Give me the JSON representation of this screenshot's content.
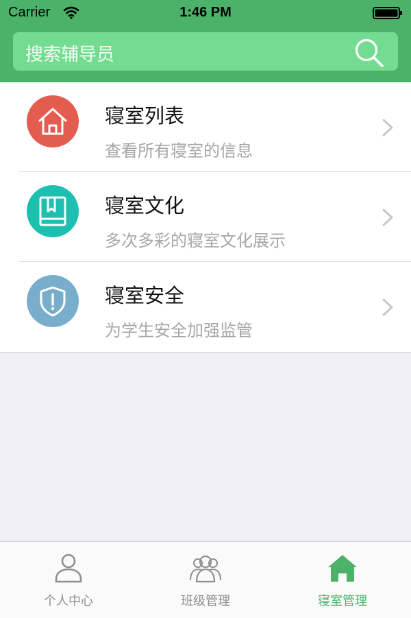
{
  "status_bar": {
    "carrier": "Carrier",
    "time": "1:46 PM"
  },
  "search": {
    "placeholder": "搜索辅导员"
  },
  "menu": [
    {
      "title": "寝室列表",
      "subtitle": "查看所有寝室的信息",
      "icon": "house-icon",
      "color": "#e45b50"
    },
    {
      "title": "寝室文化",
      "subtitle": "多次多彩的寝室文化展示",
      "icon": "book-icon",
      "color": "#1dbfb0"
    },
    {
      "title": "寝室安全",
      "subtitle": "为学生安全加强监管",
      "icon": "shield-icon",
      "color": "#78aecb"
    }
  ],
  "tabs": [
    {
      "label": "个人中心",
      "icon": "person-icon",
      "active": false
    },
    {
      "label": "班级管理",
      "icon": "group-icon",
      "active": false
    },
    {
      "label": "寝室管理",
      "icon": "home-icon",
      "active": true
    }
  ],
  "colors": {
    "brand_green": "#4cb26a",
    "search_bg": "#74dc91",
    "inactive_tab": "#8e8e8e"
  }
}
